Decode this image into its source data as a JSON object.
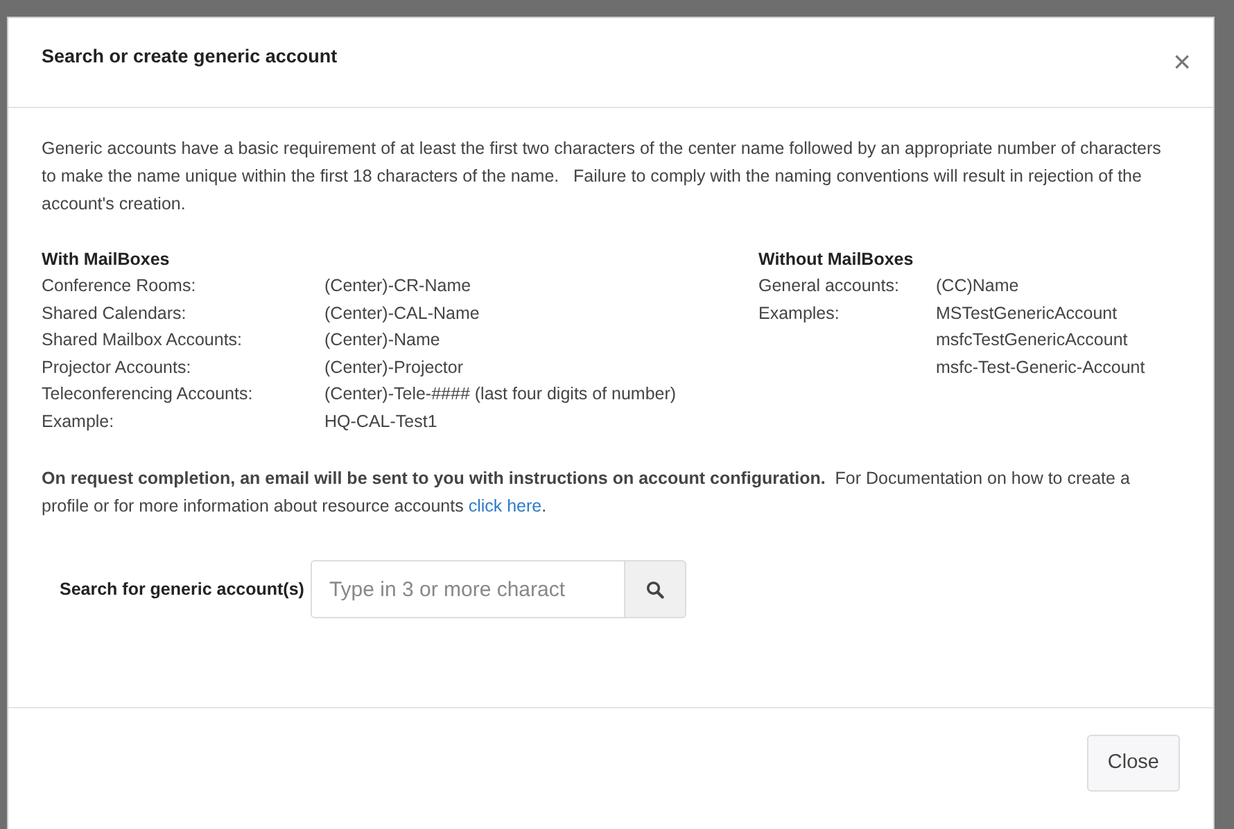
{
  "dialog": {
    "title": "Search or create generic account",
    "close_icon": "×",
    "intro": "Generic accounts have a basic requirement of at least the first two characters of the center name followed by an appropriate number of characters to make the name unique within the first 18 characters of the name.   Failure to comply with the naming conventions will result in rejection of the account's creation.",
    "with_mailboxes": {
      "heading": "With MailBoxes",
      "rows": [
        {
          "label": "Conference Rooms:",
          "value": "(Center)-CR-Name"
        },
        {
          "label": "Shared Calendars:",
          "value": "(Center)-CAL-Name"
        },
        {
          "label": "Shared Mailbox Accounts:",
          "value": "(Center)-Name"
        },
        {
          "label": "Projector Accounts:",
          "value": "(Center)-Projector"
        },
        {
          "label": "Teleconferencing Accounts:",
          "value": "(Center)-Tele-#### (last four digits of number)"
        },
        {
          "label": "Example:",
          "value": "HQ-CAL-Test1"
        }
      ]
    },
    "without_mailboxes": {
      "heading": "Without MailBoxes",
      "rows": [
        {
          "label": "General accounts:",
          "value": "(CC)Name"
        },
        {
          "label": "Examples:",
          "value": "MSTestGenericAccount"
        },
        {
          "label": "",
          "value": "msfcTestGenericAccount"
        },
        {
          "label": "",
          "value": "msfc-Test-Generic-Account"
        }
      ]
    },
    "note": "**On request completion, an email will be sent to you with instructions on account configuration.**  For Documentation on how to create a profile or for more information about resource accounts",
    "note_link": "click here",
    "note_end": ".",
    "search": {
      "label": "Search for generic account(s)",
      "placeholder": "Type in 3 or more charact"
    },
    "buttons": [
      "Close"
    ]
  }
}
